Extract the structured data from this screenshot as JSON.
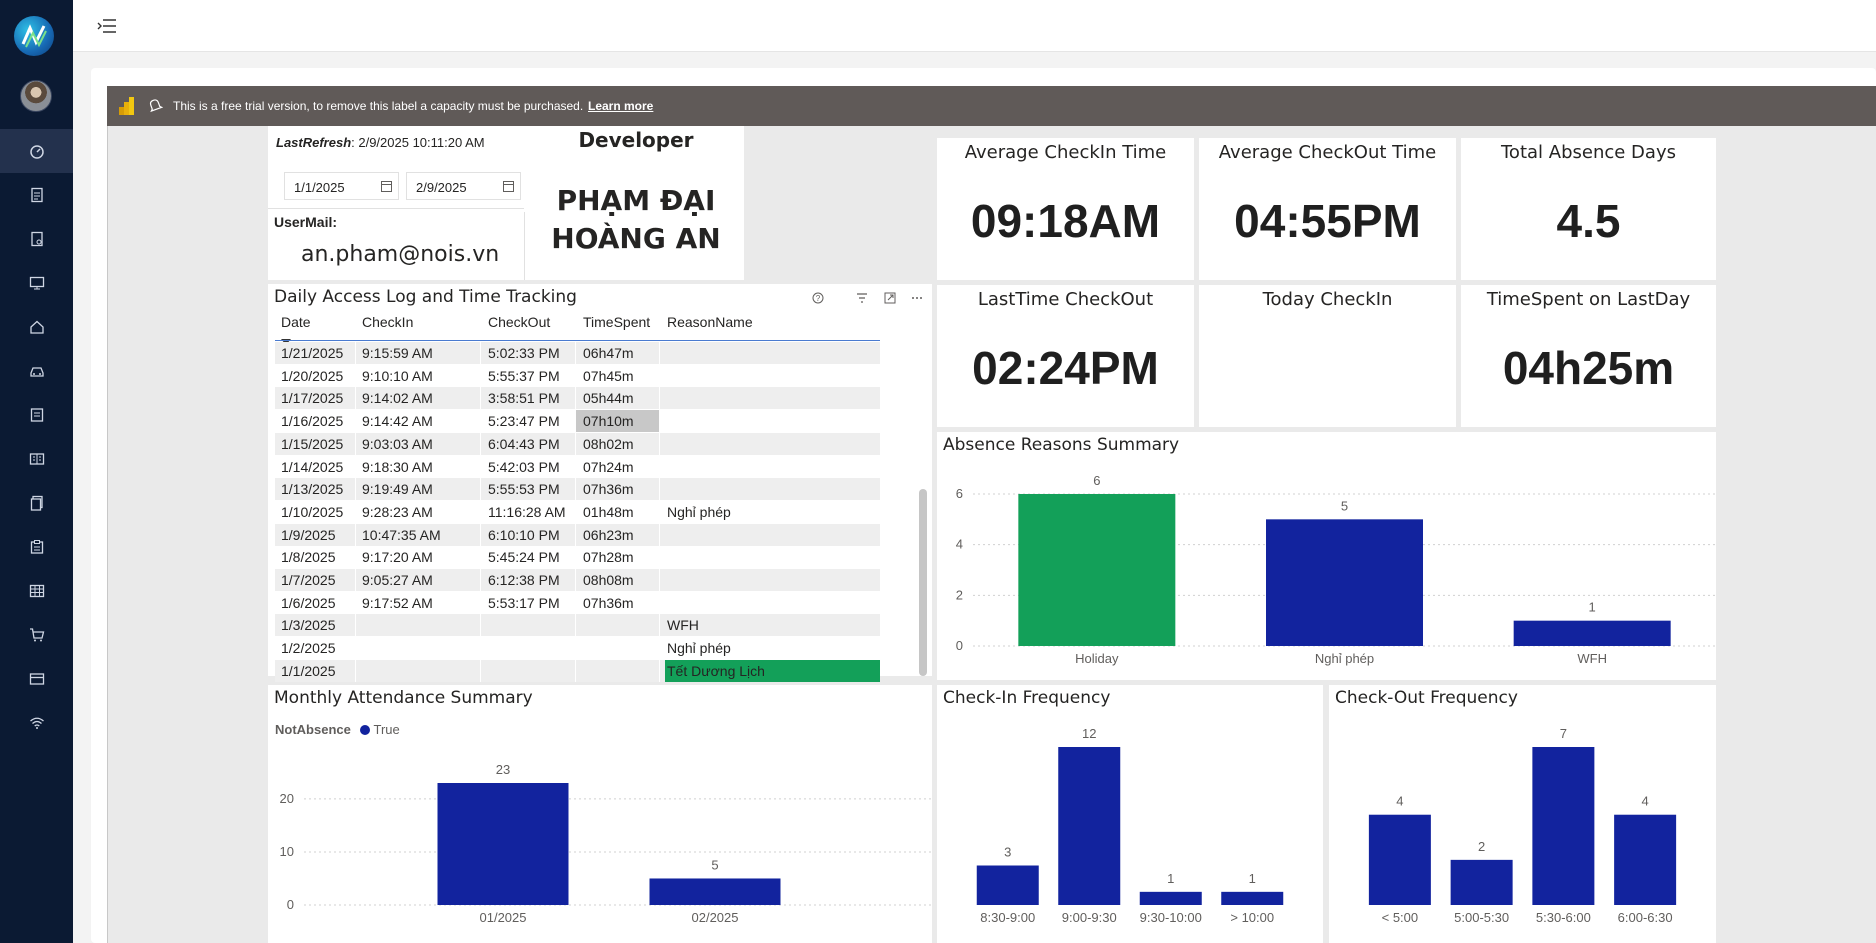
{
  "trial_banner": {
    "message": "This is a free trial version, to remove this label a capacity must be purchased.",
    "learn_more": "Learn more"
  },
  "info": {
    "last_refresh_label": "LastRefresh",
    "last_refresh_value": ": 2/9/2025 10:11:20 AM",
    "date_from": "1/1/2025",
    "date_to": "2/9/2025",
    "usermail_label": "UserMail:",
    "usermail_value": "an.pham@nois.vn",
    "developer_label": "Developer",
    "developer_name_line1": "PHẠM ĐẠI",
    "developer_name_line2": "HOÀNG AN"
  },
  "kpis": {
    "avg_checkin": {
      "title": "Average CheckIn Time",
      "value": "09:18AM"
    },
    "avg_checkout": {
      "title": "Average CheckOut Time",
      "value": "04:55PM"
    },
    "total_absence": {
      "title": "Total Absence Days",
      "value": "4.5"
    },
    "last_checkout": {
      "title": "LastTime CheckOut",
      "value": "02:24PM"
    },
    "today_checkin": {
      "title": "Today CheckIn",
      "value": ""
    },
    "timespent_last": {
      "title": "TimeSpent on LastDay",
      "value": "04h25m"
    }
  },
  "log_table": {
    "title": "Daily Access Log and Time Tracking",
    "columns": [
      "Date",
      "CheckIn",
      "CheckOut",
      "TimeSpent",
      "ReasonName"
    ],
    "rows": [
      [
        "1/21/2025",
        "9:15:59 AM",
        "5:02:33 PM",
        "06h47m",
        ""
      ],
      [
        "1/20/2025",
        "9:10:10 AM",
        "5:55:37 PM",
        "07h45m",
        ""
      ],
      [
        "1/17/2025",
        "9:14:02 AM",
        "3:58:51 PM",
        "05h44m",
        ""
      ],
      [
        "1/16/2025",
        "9:14:42 AM",
        "5:23:47 PM",
        "07h10m",
        ""
      ],
      [
        "1/15/2025",
        "9:03:03 AM",
        "6:04:43 PM",
        "08h02m",
        ""
      ],
      [
        "1/14/2025",
        "9:18:30 AM",
        "5:42:03 PM",
        "07h24m",
        ""
      ],
      [
        "1/13/2025",
        "9:19:49 AM",
        "5:55:53 PM",
        "07h36m",
        ""
      ],
      [
        "1/10/2025",
        "9:28:23 AM",
        "11:16:28 AM",
        "01h48m",
        "Nghỉ phép"
      ],
      [
        "1/9/2025",
        "10:47:35 AM",
        "6:10:10 PM",
        "06h23m",
        ""
      ],
      [
        "1/8/2025",
        "9:17:20 AM",
        "5:45:24 PM",
        "07h28m",
        ""
      ],
      [
        "1/7/2025",
        "9:05:27 AM",
        "6:12:38 PM",
        "08h08m",
        ""
      ],
      [
        "1/6/2025",
        "9:17:52 AM",
        "5:53:17 PM",
        "07h36m",
        ""
      ],
      [
        "1/3/2025",
        "",
        "",
        "",
        "WFH"
      ],
      [
        "1/2/2025",
        "",
        "",
        "",
        "Nghỉ phép"
      ],
      [
        "1/1/2025",
        "",
        "",
        "",
        "Tết Dương Lịch"
      ]
    ]
  },
  "chart_data": [
    {
      "id": "absence",
      "type": "bar",
      "title": "Absence Reasons Summary",
      "categories": [
        "Holiday",
        "Nghỉ phép",
        "WFH"
      ],
      "values": [
        6,
        5,
        1
      ],
      "colors": [
        "#13a059",
        "#12239e",
        "#12239e"
      ],
      "yticks": [
        0,
        2,
        4,
        6
      ],
      "ylim": [
        0,
        6
      ]
    },
    {
      "id": "monthly",
      "type": "bar",
      "title": "Monthly Attendance Summary",
      "legend_title": "NotAbsence",
      "series": [
        {
          "name": "True",
          "values": [
            23,
            5
          ]
        }
      ],
      "categories": [
        "01/2025",
        "02/2025"
      ],
      "values": [
        23,
        5
      ],
      "yticks": [
        0,
        10,
        20
      ],
      "ylim": [
        0,
        23
      ]
    },
    {
      "id": "checkin",
      "type": "bar",
      "title": "Check-In Frequency",
      "categories": [
        "8:30-9:00",
        "9:00-9:30",
        "9:30-10:00",
        "> 10:00"
      ],
      "values": [
        3,
        12,
        1,
        1
      ]
    },
    {
      "id": "checkout",
      "type": "bar",
      "title": "Check-Out Frequency",
      "categories": [
        "< 5:00",
        "5:00-5:30",
        "5:30-6:00",
        "6:00-6:30"
      ],
      "values": [
        4,
        2,
        7,
        4
      ]
    }
  ],
  "colors": {
    "bar": "#12239e",
    "holiday": "#13a059",
    "sidebar": "#0b1a33",
    "banner": "#605a58"
  }
}
